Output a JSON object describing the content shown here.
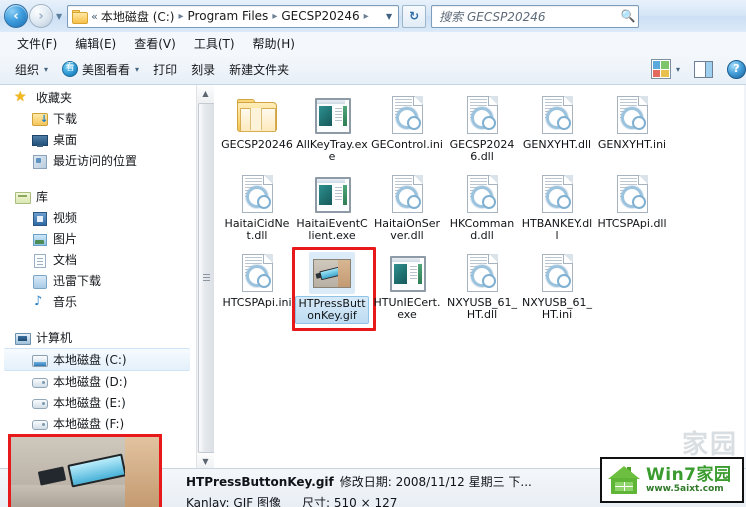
{
  "window": {
    "address": {
      "folder_icon": "folder-icon",
      "overflow_chevron": "«",
      "crumbs": [
        "本地磁盘 (C:)",
        "Program Files",
        "GECSP20246"
      ],
      "separator": "▸",
      "dropdown_icon": "chevron-down-icon",
      "refresh_icon": "↻"
    },
    "nav": {
      "back_icon": "◀",
      "forward_icon": "▶",
      "history_dropdown_icon": "▾"
    },
    "search": {
      "placeholder": "搜索 GECSP20246",
      "icon": "search-icon"
    }
  },
  "menubar": {
    "items": [
      {
        "label": "文件(F)"
      },
      {
        "label": "编辑(E)"
      },
      {
        "label": "查看(V)"
      },
      {
        "label": "工具(T)"
      },
      {
        "label": "帮助(H)"
      }
    ]
  },
  "toolbar": {
    "organize_label": "组织",
    "meitu_label": "美图看看",
    "print_label": "打印",
    "burn_label": "刻录",
    "newfolder_label": "新建文件夹",
    "caret_icon": "▾",
    "view_icon": "view-mode-icon",
    "preview_pane_icon": "preview-pane-icon",
    "help_icon": "?"
  },
  "sidebar": {
    "groups": [
      {
        "header": {
          "label": "收藏夹",
          "icon": "star-icon"
        },
        "items": [
          {
            "label": "下载",
            "icon": "downloads-folder-icon"
          },
          {
            "label": "桌面",
            "icon": "desktop-icon"
          },
          {
            "label": "最近访问的位置",
            "icon": "recent-places-icon"
          }
        ]
      },
      {
        "header": {
          "label": "库",
          "icon": "library-icon"
        },
        "items": [
          {
            "label": "视频",
            "icon": "videos-icon"
          },
          {
            "label": "图片",
            "icon": "pictures-icon"
          },
          {
            "label": "文档",
            "icon": "documents-icon"
          },
          {
            "label": "迅雷下载",
            "icon": "xunlei-download-icon"
          },
          {
            "label": "音乐",
            "icon": "music-icon"
          }
        ]
      },
      {
        "header": {
          "label": "计算机",
          "icon": "computer-icon"
        },
        "items": [
          {
            "label": "本地磁盘 (C:)",
            "icon": "system-drive-icon",
            "selected": true
          },
          {
            "label": "本地磁盘 (D:)",
            "icon": "drive-icon"
          },
          {
            "label": "本地磁盘 (E:)",
            "icon": "drive-icon"
          },
          {
            "label": "本地磁盘 (F:)",
            "icon": "drive-icon"
          }
        ]
      }
    ]
  },
  "files": [
    {
      "name": "GECSP20246",
      "type": "folder"
    },
    {
      "name": "AllKeyTray.exe",
      "type": "app"
    },
    {
      "name": "GEControl.ini",
      "type": "config"
    },
    {
      "name": "GECSP20246.dll",
      "type": "config"
    },
    {
      "name": "GENXYHT.dll",
      "type": "config"
    },
    {
      "name": "GENXYHT.ini",
      "type": "config"
    },
    {
      "name": "HaitaiCidNet.dll",
      "type": "config"
    },
    {
      "name": "HaitaiEventClient.exe",
      "type": "app"
    },
    {
      "name": "HaitaiOnServer.dll",
      "type": "config"
    },
    {
      "name": "HKCommand.dll",
      "type": "config"
    },
    {
      "name": "HTBANKEY.dll",
      "type": "config"
    },
    {
      "name": "HTCSPApi.dll",
      "type": "config"
    },
    {
      "name": "HTCSPApi.ini",
      "type": "config"
    },
    {
      "name": "HTPressButtonKey.gif",
      "type": "gif",
      "selected": true,
      "annotated": true
    },
    {
      "name": "HTUnIECert.exe",
      "type": "app"
    },
    {
      "name": "NXYUSB_61_HT.dll",
      "type": "config"
    },
    {
      "name": "NXYUSB_61_HT.ini",
      "type": "config"
    }
  ],
  "statusbar": {
    "filename": "HTPressButtonKey.gif",
    "modified_label": "修改日期: 2008/11/12 星期三 下...",
    "kind_label": "Kanlay: GIF 图像",
    "dimensions_label": "尺寸: 510 × 127",
    "preview_annotated": true
  },
  "watermark": {
    "title": "Win7家园",
    "url": "www.5aixt.com",
    "logo_icon": "win7-home-logo-icon"
  },
  "colors": {
    "annotation_red": "#e8191b",
    "selection_blue": "#bedcf2",
    "watermark_green": "#3a9c2f",
    "folder_yellow": "#fcd87d"
  }
}
